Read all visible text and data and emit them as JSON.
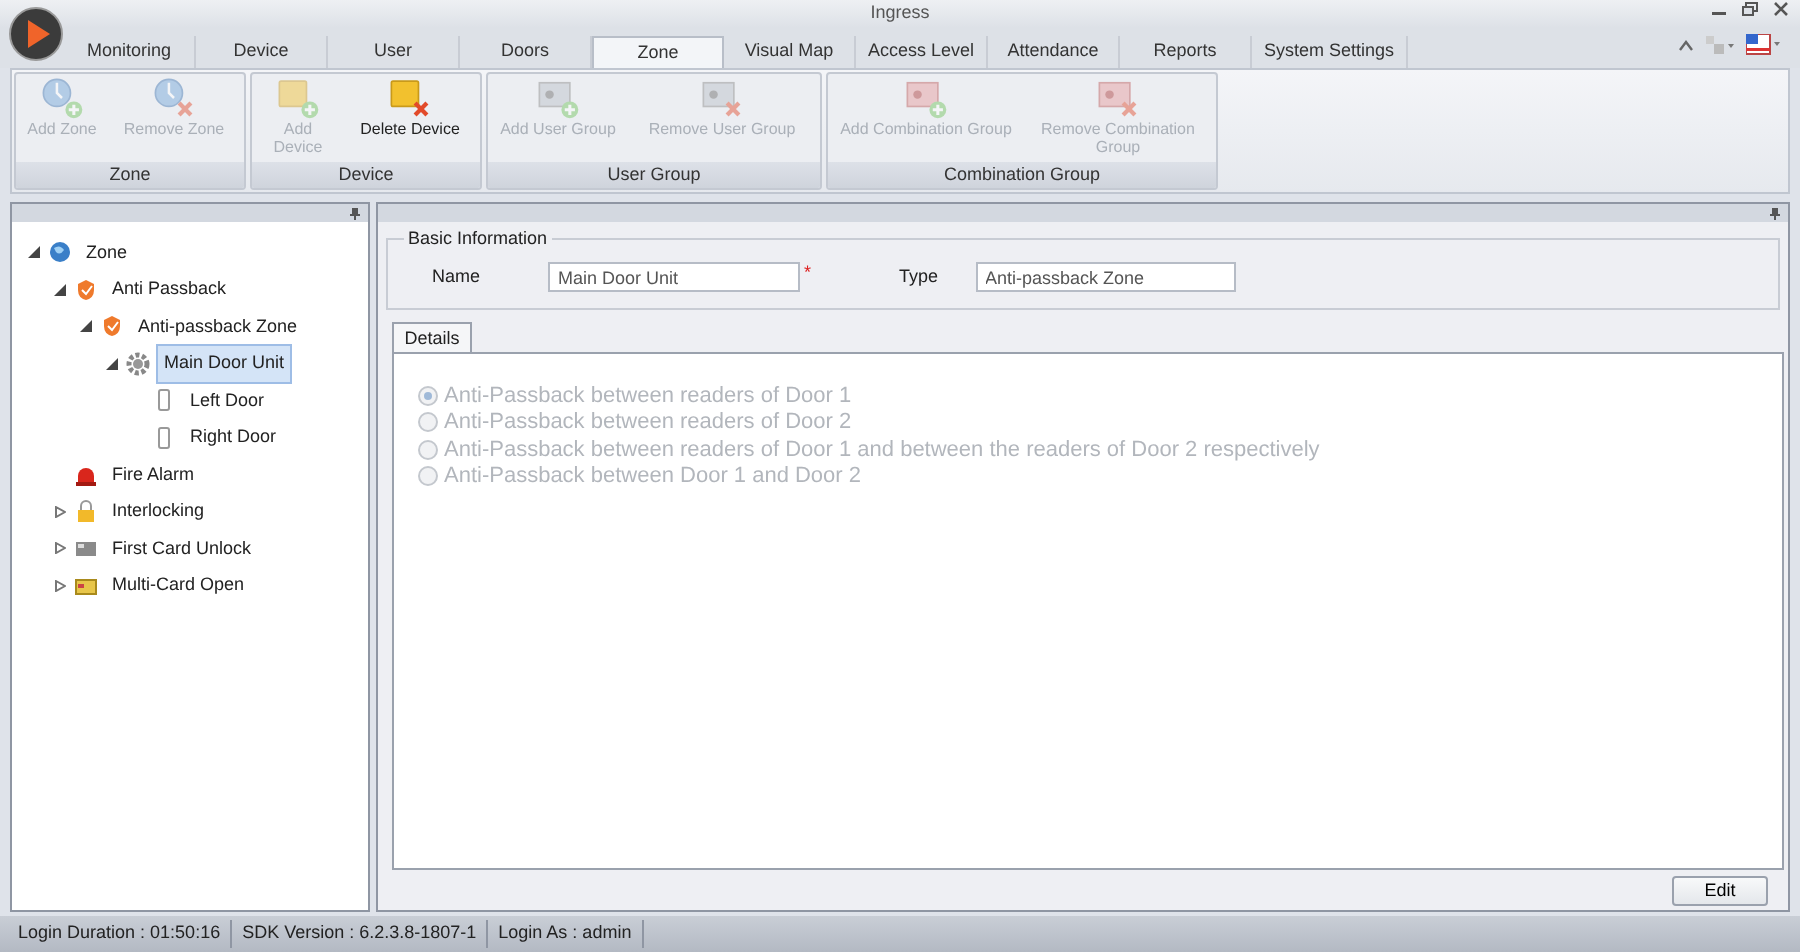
{
  "window": {
    "title": "Ingress"
  },
  "tabs": [
    {
      "label": "Monitoring",
      "selected": false
    },
    {
      "label": "Device",
      "selected": false
    },
    {
      "label": "User",
      "selected": false
    },
    {
      "label": "Doors",
      "selected": false
    },
    {
      "label": "Zone",
      "selected": true
    },
    {
      "label": "Visual Map",
      "selected": false
    },
    {
      "label": "Access Level",
      "selected": false
    },
    {
      "label": "Attendance",
      "selected": false
    },
    {
      "label": "Reports",
      "selected": false
    },
    {
      "label": "System Settings",
      "selected": false
    }
  ],
  "ribbon": [
    {
      "label": "Zone",
      "buttons": [
        {
          "label": "Add Zone",
          "kind": "zone-add",
          "disabled": true
        },
        {
          "label": "Remove Zone",
          "kind": "zone-remove",
          "disabled": true
        }
      ]
    },
    {
      "label": "Device",
      "buttons": [
        {
          "label": "Add Device",
          "kind": "device-add",
          "disabled": true
        },
        {
          "label": "Delete Device",
          "kind": "device-remove",
          "disabled": false
        }
      ]
    },
    {
      "label": "User Group",
      "buttons": [
        {
          "label": "Add User Group",
          "kind": "group-add",
          "disabled": true
        },
        {
          "label": "Remove User Group",
          "kind": "group-remove",
          "disabled": true
        }
      ]
    },
    {
      "label": "Combination Group",
      "buttons": [
        {
          "label": "Add Combination Group",
          "kind": "combo-add",
          "disabled": true
        },
        {
          "label": "Remove Combination Group",
          "kind": "combo-remove",
          "disabled": true
        }
      ]
    }
  ],
  "tree": [
    {
      "label": "Zone",
      "kind": "globe",
      "expanded": true,
      "selected": false,
      "children": [
        {
          "label": "Anti Passback",
          "kind": "shield",
          "expanded": true,
          "selected": false,
          "children": [
            {
              "label": "Anti-passback Zone",
              "kind": "shield",
              "expanded": true,
              "selected": false,
              "children": [
                {
                  "label": "Main Door Unit",
                  "kind": "gear",
                  "expanded": true,
                  "selected": true,
                  "children": [
                    {
                      "label": "Left Door",
                      "kind": "door",
                      "selected": false
                    },
                    {
                      "label": "Right Door",
                      "kind": "door",
                      "selected": false
                    }
                  ]
                }
              ]
            }
          ]
        },
        {
          "label": "Fire Alarm",
          "kind": "alarm",
          "selected": false
        },
        {
          "label": "Interlocking",
          "kind": "lock",
          "expanded": false,
          "selected": false
        },
        {
          "label": "First Card Unlock",
          "kind": "card",
          "expanded": false,
          "selected": false
        },
        {
          "label": "Multi-Card Open",
          "kind": "cardyellow",
          "expanded": false,
          "selected": false
        }
      ]
    }
  ],
  "basic_info": {
    "title": "Basic Information",
    "name_label": "Name",
    "name_value": "Main Door Unit",
    "required_mark": "*",
    "type_label": "Type",
    "type_value": "Anti-passback Zone"
  },
  "details": {
    "tab": "Details",
    "options": [
      {
        "label": "Anti-Passback between readers of Door 1",
        "selected": true,
        "disabled": true
      },
      {
        "label": "Anti-Passback between readers of Door 2",
        "selected": false,
        "disabled": true
      },
      {
        "label": "Anti-Passback between readers of Door 1 and between the readers of Door 2 respectively",
        "selected": false,
        "disabled": true
      },
      {
        "label": "Anti-Passback between Door 1 and Door 2",
        "selected": false,
        "disabled": true
      }
    ]
  },
  "edit_button": "Edit",
  "status_bar": [
    "Login Duration : 01:50:16",
    "SDK Version : 6.2.3.8-1807-1",
    "Login As : admin"
  ]
}
